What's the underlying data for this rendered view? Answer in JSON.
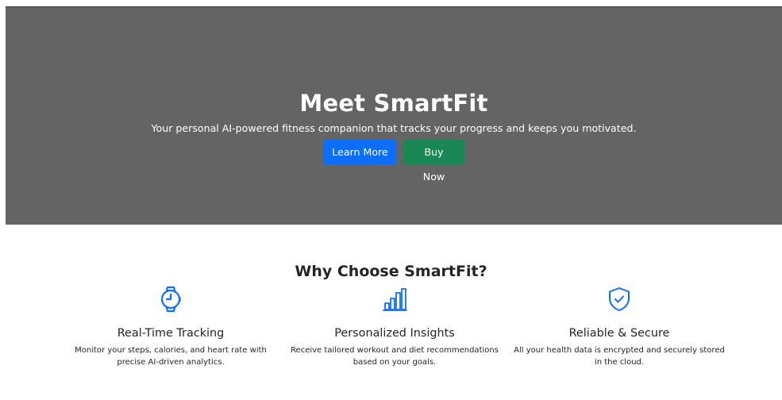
{
  "hero": {
    "title": "Meet SmartFit",
    "subtitle": "Your personal AI-powered fitness companion that tracks your progress and keeps you motivated.",
    "buttons": {
      "learn_more": "Learn More",
      "buy_now": "Buy Now"
    },
    "background_color": "#646464"
  },
  "features_section": {
    "title": "Why Choose SmartFit?",
    "items": [
      {
        "icon": "smartwatch-icon",
        "title": "Real-Time Tracking",
        "text": "Monitor your steps, calories, and heart rate with precise AI-driven analytics."
      },
      {
        "icon": "bar-chart-icon",
        "title": "Personalized Insights",
        "text": "Receive tailored workout and diet recommendations based on your goals."
      },
      {
        "icon": "shield-check-icon",
        "title": "Reliable & Secure",
        "text": "All your health data is encrypted and securely stored in the cloud."
      }
    ]
  },
  "colors": {
    "primary": "#0d6efd",
    "success": "#198754",
    "text": "#212529"
  }
}
